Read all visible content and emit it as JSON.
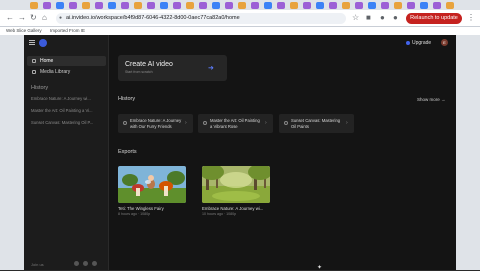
{
  "browser": {
    "url": "ai.invideo.io/workspace/b4f9d87-6046-4322-8d00-0aec77ca82a0/home",
    "relaunch_label": "Relaunch to update",
    "bookmarks": [
      "Web Slice Gallery",
      "Imported From IE"
    ]
  },
  "sidebar": {
    "items": [
      {
        "label": "Home",
        "icon": "home-icon"
      },
      {
        "label": "Media Library",
        "icon": "media-icon"
      }
    ],
    "history_title": "History",
    "history_items": [
      "Embrace Nature: A Journey wi...",
      "Master the Art: Oil Painting a Vi...",
      "Sunset Canvas: Mastering Oil P..."
    ],
    "footer": "Join us"
  },
  "topbar": {
    "upgrade_label": "Upgrade"
  },
  "create": {
    "title": "Create AI video",
    "subtitle": "Start from scratch"
  },
  "history": {
    "title": "History",
    "show_more": "Show more",
    "cards": [
      "Embrace Nature: A Journey with Our Furry Friends",
      "Master the Art: Oil Painting a Vibrant Rose",
      "Sunset Canvas: Mastering Oil Paints"
    ]
  },
  "exports": {
    "title": "Exports",
    "videos": [
      {
        "name": "Teti: The Wingless Fairy",
        "meta": "8 hours ago · 1080p"
      },
      {
        "name": "Embrace Nature: A Journey wi...",
        "meta": "10 hours ago · 1080p"
      }
    ]
  },
  "colors": {
    "accent": "#4263eb",
    "background": "#141414",
    "sidebar": "#1c1c1c",
    "relaunch": "#c5221f"
  }
}
